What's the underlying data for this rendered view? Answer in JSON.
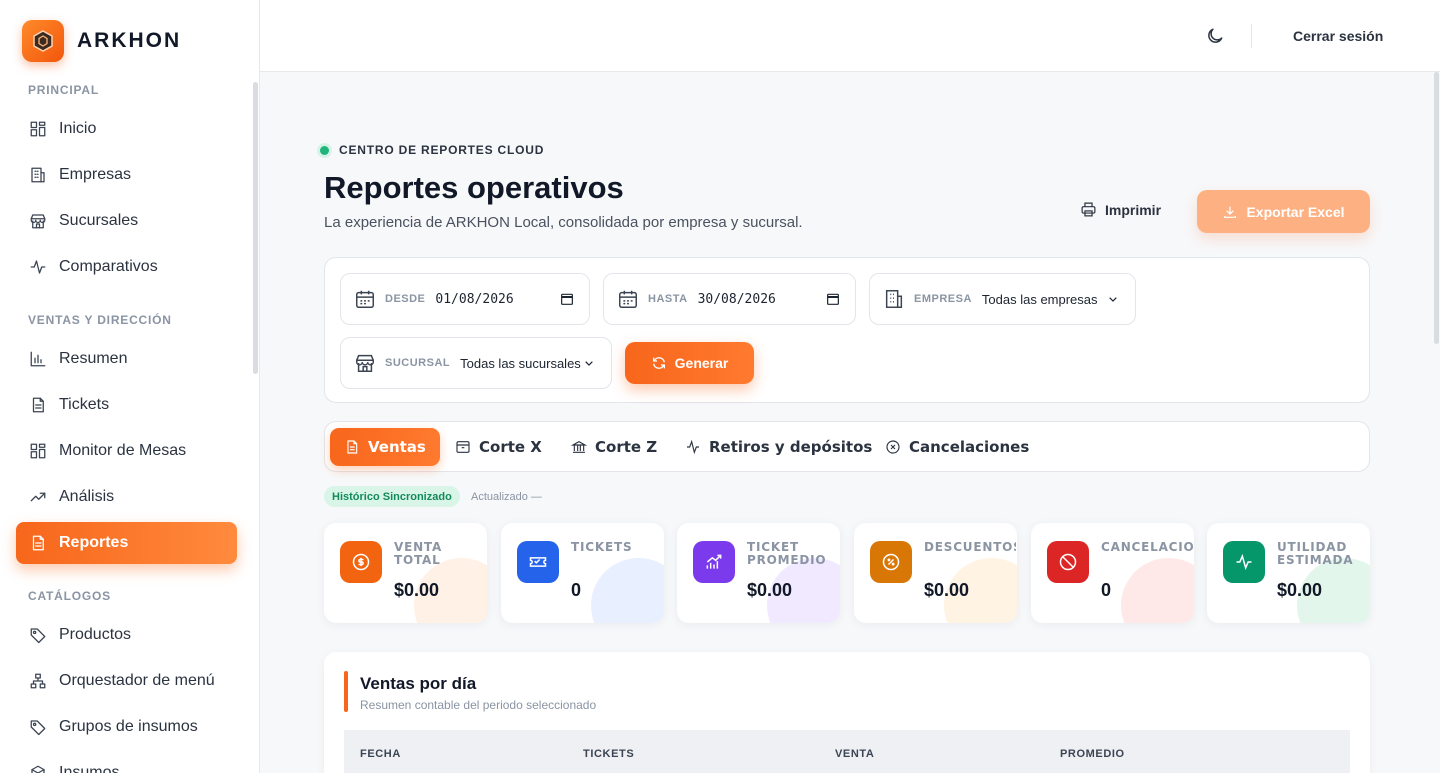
{
  "brand": {
    "name": "ARKHON"
  },
  "sidebar": {
    "sections": [
      "PRINCIPAL",
      "VENTAS Y DIRECCIÓN",
      "CATÁLOGOS"
    ],
    "items": [
      {
        "label": "Inicio",
        "icon": "grid-icon"
      },
      {
        "label": "Empresas",
        "icon": "building-icon"
      },
      {
        "label": "Sucursales",
        "icon": "store-icon"
      },
      {
        "label": "Comparativos",
        "icon": "activity-icon"
      },
      {
        "label": "Resumen",
        "icon": "bar-chart-icon"
      },
      {
        "label": "Tickets",
        "icon": "document-icon"
      },
      {
        "label": "Monitor de Mesas",
        "icon": "grid-icon"
      },
      {
        "label": "Análisis",
        "icon": "trending-up-icon"
      },
      {
        "label": "Reportes",
        "icon": "document-icon",
        "active": true
      },
      {
        "label": "Productos",
        "icon": "tag-icon"
      },
      {
        "label": "Orquestador de menú",
        "icon": "sitemap-icon"
      },
      {
        "label": "Grupos de insumos",
        "icon": "tag-icon"
      },
      {
        "label": "Insumos",
        "icon": "box-icon"
      }
    ]
  },
  "topbar": {
    "logout": "Cerrar sesión"
  },
  "header": {
    "eyebrow": "CENTRO DE REPORTES CLOUD",
    "title": "Reportes operativos",
    "subtitle": "La experiencia de ARKHON Local, consolidada por empresa y sucursal.",
    "print": "Imprimir",
    "export": "Exportar Excel"
  },
  "filters": {
    "desde": {
      "label": "DESDE",
      "value": "01/08/2026"
    },
    "hasta": {
      "label": "HASTA",
      "value": "30/08/2026"
    },
    "empresa": {
      "label": "EMPRESA",
      "value": "Todas las empresas"
    },
    "sucursal": {
      "label": "SUCURSAL",
      "value": "Todas las sucursales"
    },
    "generate": "Generar"
  },
  "tabs": [
    "Ventas",
    "Corte X",
    "Corte Z",
    "Retiros y depósitos",
    "Cancelaciones"
  ],
  "status": {
    "badge": "Histórico Sincronizado",
    "updated": "Actualizado —"
  },
  "kpis": [
    {
      "label": "VENTA TOTAL",
      "value": "$0.00",
      "color": "#f2640f"
    },
    {
      "label": "TICKETS",
      "value": "0",
      "color": "#2563eb"
    },
    {
      "label": "TICKET PROMEDIO",
      "value": "$0.00",
      "color": "#7c3aed"
    },
    {
      "label": "DESCUENTOS",
      "value": "$0.00",
      "color": "#d97706"
    },
    {
      "label": "CANCELACIONES",
      "value": "0",
      "color": "#dc2626"
    },
    {
      "label": "UTILIDAD ESTIMADA",
      "value": "$0.00",
      "color": "#059669"
    }
  ],
  "table": {
    "title": "Ventas por día",
    "subtitle": "Resumen contable del periodo seleccionado",
    "columns": [
      "FECHA",
      "TICKETS",
      "VENTA",
      "PROMEDIO"
    ]
  }
}
